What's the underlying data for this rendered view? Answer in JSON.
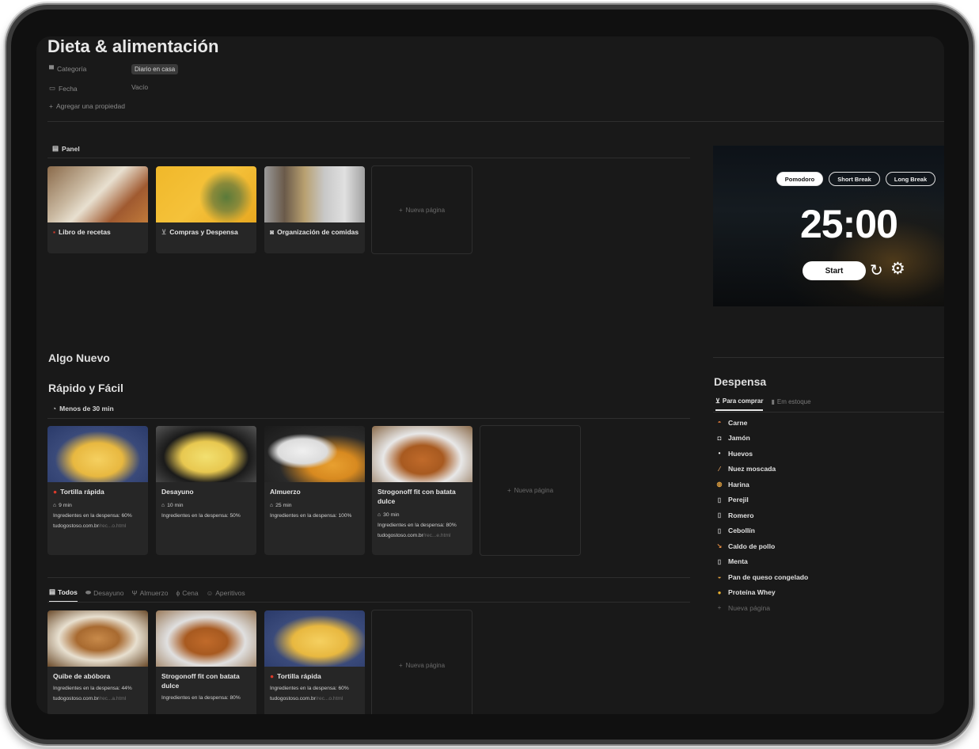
{
  "page": {
    "title": "Dieta & alimentación",
    "properties": [
      {
        "label": "Categoría",
        "value": "Diario en casa"
      },
      {
        "label": "Fecha",
        "value": "Vacío"
      }
    ],
    "add_property": "Agregar una propiedad"
  },
  "panel": {
    "label": "Panel",
    "cards": [
      {
        "title": "Libro de recetas",
        "icon": "book-icon"
      },
      {
        "title": "Compras y Despensa",
        "icon": "cart-icon"
      },
      {
        "title": "Organización de comidas",
        "icon": "calendar-icon"
      }
    ],
    "new_page": "Nueva página"
  },
  "algo_nuevo": "Algo Nuevo",
  "rapido": {
    "heading": "Rápido y Fácil",
    "filter_label": "Menos de 30 min",
    "cards": [
      {
        "title": "Tortilla rápida",
        "time": "9 min",
        "pantry": "Ingredientes en la despensa: 60%",
        "link_domain": "tudogostoso.com.br",
        "link_rest": "/rec...o.html"
      },
      {
        "title": "Desayuno",
        "time": "10 min",
        "pantry": "Ingredientes en la despensa: 50%"
      },
      {
        "title": "Almuerzo",
        "time": "25 min",
        "pantry": "Ingredientes en la despensa: 100%"
      },
      {
        "title": "Strogonoff fit con batata dulce",
        "time": "30 min",
        "pantry": "Ingredientes en la despensa: 80%",
        "link_domain": "tudogostoso.com.br",
        "link_rest": "/rec...e.html"
      }
    ],
    "new_page": "Nueva página"
  },
  "bottom": {
    "tabs": [
      "Todos",
      "Desayuno",
      "Almuerzo",
      "Cena",
      "Aperitivos"
    ],
    "cards": [
      {
        "title": "Quibe de abóbora",
        "pantry": "Ingredientes en la despensa: 44%",
        "link_domain": "tudogostoso.com.br",
        "link_rest": "/rec...a.html"
      },
      {
        "title": "Strogonoff fit con batata dulce",
        "pantry": "Ingredientes en la despensa: 80%"
      },
      {
        "title": "Tortilla rápida",
        "pantry": "Ingredientes en la despensa: 60%",
        "link_domain": "tudogostoso.com.br",
        "link_rest": "/rec...o.html"
      }
    ],
    "new_page": "Nueva página"
  },
  "pomodoro": {
    "modes": [
      "Pomodoro",
      "Short Break",
      "Long Break"
    ],
    "time": "25:00",
    "start": "Start"
  },
  "despensa": {
    "heading": "Despensa",
    "tabs": [
      "Para comprar",
      "Em estoque"
    ],
    "items": [
      {
        "name": "Carne",
        "icon": "meat-icon"
      },
      {
        "name": "Jamón",
        "icon": "ham-icon"
      },
      {
        "name": "Huevos",
        "icon": "egg-icon"
      },
      {
        "name": "Nuez moscada",
        "icon": "nut-icon"
      },
      {
        "name": "Harina",
        "icon": "flour-icon"
      },
      {
        "name": "Perejil",
        "icon": "page-icon"
      },
      {
        "name": "Romero",
        "icon": "page-icon"
      },
      {
        "name": "Cebollín",
        "icon": "page-icon"
      },
      {
        "name": "Caldo de pollo",
        "icon": "drumstick-icon"
      },
      {
        "name": "Menta",
        "icon": "page-icon"
      },
      {
        "name": "Pan de queso congelado",
        "icon": "bread-icon"
      },
      {
        "name": "Proteína Whey",
        "icon": "protein-icon"
      }
    ],
    "new_page": "Nueva página"
  },
  "colors": {
    "background": "#191919",
    "card": "#262626",
    "accent_red": "#d93a2b"
  }
}
